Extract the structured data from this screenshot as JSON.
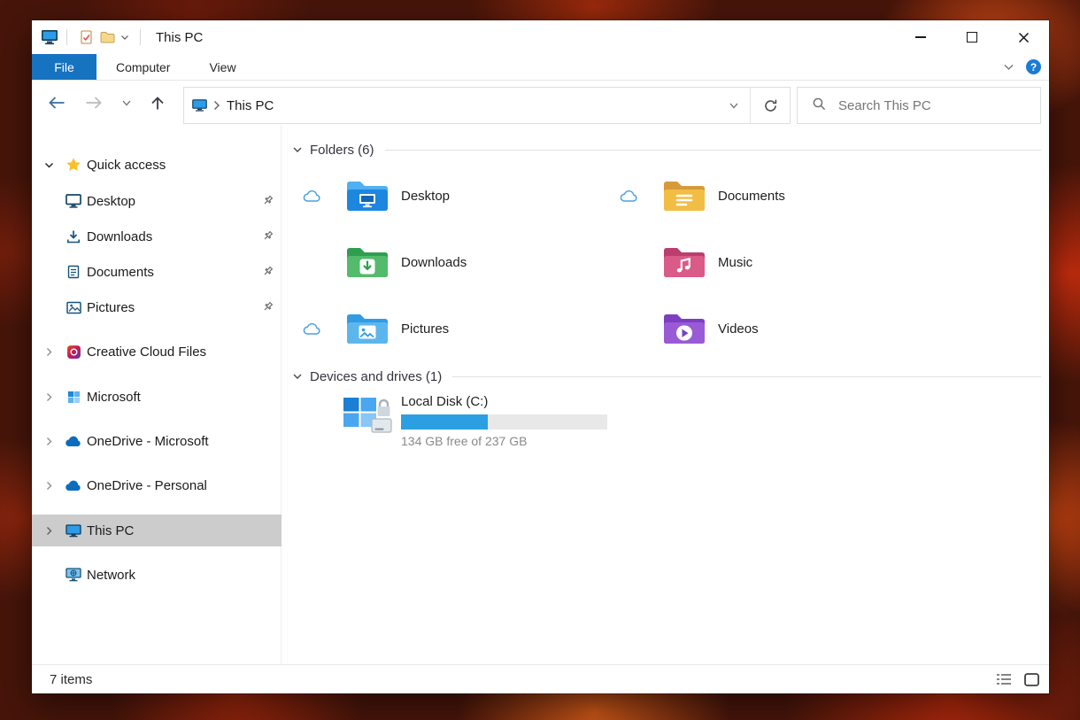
{
  "window": {
    "title": "This PC",
    "app_icon": "this-pc-icon"
  },
  "titlebar": {
    "quick_access_toolbar": {
      "icons": [
        "properties-icon",
        "new-folder-icon",
        "customize-chevron-icon"
      ]
    }
  },
  "ribbon": {
    "tabs": [
      "File",
      "Computer",
      "View"
    ],
    "help_label": "?"
  },
  "navigation": {
    "back_icon": "back-arrow-icon",
    "forward_icon": "forward-arrow-icon",
    "up_icon": "up-arrow-icon",
    "refresh_icon": "refresh-icon",
    "breadcrumb_location": "This PC",
    "search_placeholder": "Search This PC"
  },
  "sidebar": {
    "items": [
      {
        "label": "Quick access",
        "icon": "star-icon",
        "expanded": true
      },
      {
        "label": "Desktop",
        "icon": "monitor-icon",
        "pinned": true
      },
      {
        "label": "Downloads",
        "icon": "download-arrow-icon",
        "pinned": true
      },
      {
        "label": "Documents",
        "icon": "document-icon",
        "pinned": true
      },
      {
        "label": "Pictures",
        "icon": "picture-icon",
        "pinned": true
      },
      {
        "label": "Creative Cloud Files",
        "icon": "creative-cloud-icon",
        "collapsed": true
      },
      {
        "label": "Microsoft",
        "icon": "microsoft-icon",
        "collapsed": true
      },
      {
        "label": "OneDrive - Microsoft",
        "icon": "onedrive-cloud-icon",
        "collapsed": true
      },
      {
        "label": "OneDrive - Personal",
        "icon": "onedrive-cloud-icon",
        "collapsed": true
      },
      {
        "label": "This PC",
        "icon": "this-pc-icon",
        "collapsed": true,
        "selected": true
      },
      {
        "label": "Network",
        "icon": "network-icon"
      }
    ]
  },
  "content": {
    "folders_section": {
      "title": "Folders (6)",
      "tiles": [
        {
          "name": "Desktop",
          "icon": "desktop-folder-icon",
          "cloud_status": true
        },
        {
          "name": "Documents",
          "icon": "documents-folder-icon",
          "cloud_status": true
        },
        {
          "name": "Downloads",
          "icon": "downloads-folder-icon",
          "cloud_status": false
        },
        {
          "name": "Music",
          "icon": "music-folder-icon",
          "cloud_status": false
        },
        {
          "name": "Pictures",
          "icon": "pictures-folder-icon",
          "cloud_status": true
        },
        {
          "name": "Videos",
          "icon": "videos-folder-icon",
          "cloud_status": false
        }
      ]
    },
    "devices_section": {
      "title": "Devices and drives (1)",
      "drives": [
        {
          "name": "Local Disk (C:)",
          "icon": "windows-drive-icon",
          "free_text": "134 GB free of 237 GB",
          "used_percent": 42
        }
      ]
    }
  },
  "statusbar": {
    "items_text": "7 items",
    "view_icons": [
      "details-view-icon",
      "large-icons-view-icon"
    ]
  },
  "colors": {
    "file_tab_blue": "#1673c0",
    "selection_gray": "#cccccc",
    "capacity_fill_blue": "#2b9fe2",
    "capacity_track_gray": "#e8e8e8",
    "cloud_badge_blue": "#4aa0e0"
  }
}
